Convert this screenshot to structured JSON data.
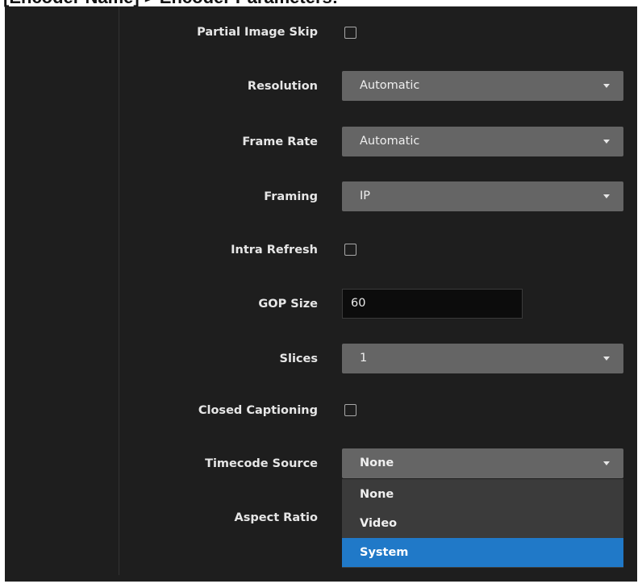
{
  "page_title": "[Encoder Name] > Encoder Parameters:",
  "form": {
    "partial_image_skip": {
      "label": "Partial Image Skip",
      "checked": false
    },
    "resolution": {
      "label": "Resolution",
      "value": "Automatic"
    },
    "frame_rate": {
      "label": "Frame Rate",
      "value": "Automatic"
    },
    "framing": {
      "label": "Framing",
      "value": "IP"
    },
    "intra_refresh": {
      "label": "Intra Refresh",
      "checked": false
    },
    "gop_size": {
      "label": "GOP Size",
      "value": "60"
    },
    "slices": {
      "label": "Slices",
      "value": "1"
    },
    "closed_captioning": {
      "label": "Closed Captioning",
      "checked": false
    },
    "timecode_source": {
      "label": "Timecode Source",
      "value": "None",
      "options": [
        "None",
        "Video",
        "System"
      ],
      "highlighted": "System"
    },
    "aspect_ratio": {
      "label": "Aspect Ratio"
    }
  },
  "colors": {
    "panel_bg": "#1e1e1e",
    "select_bg": "#656565",
    "dropdown_bg": "#3b3b3b",
    "highlight": "#2079c8"
  }
}
